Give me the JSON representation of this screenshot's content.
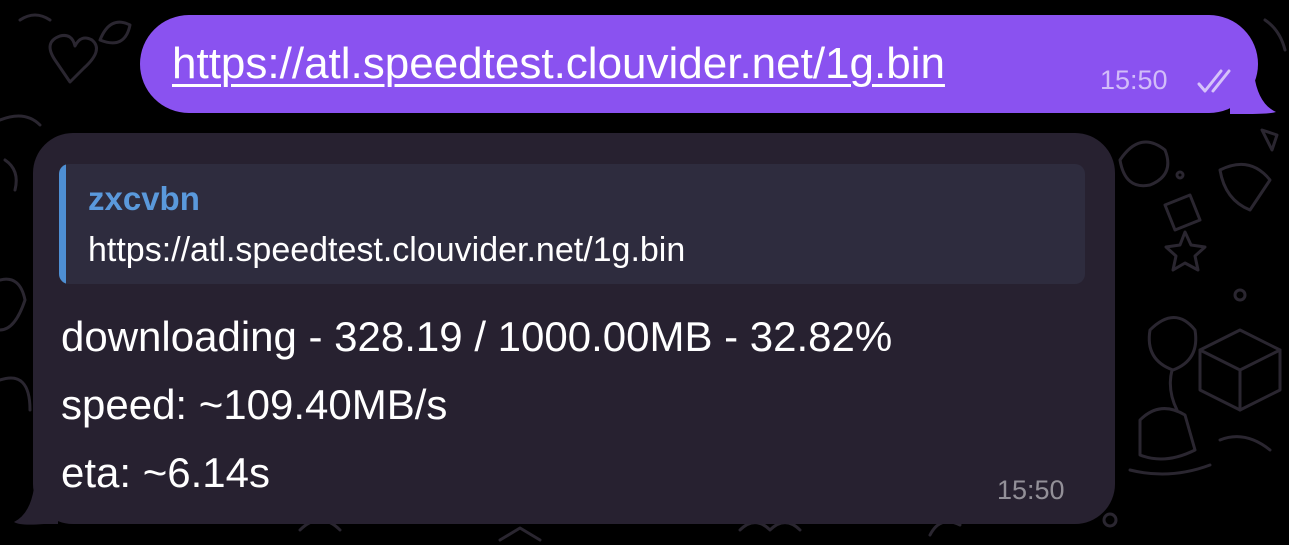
{
  "colors": {
    "background": "#000000",
    "outgoing_bubble": "#8a52f0",
    "incoming_bubble": "#272130",
    "reply_background": "#2e2c3e",
    "reply_accent": "#4e8fd3",
    "reply_name": "#5a99dc"
  },
  "outgoing_message": {
    "link_text": "https://atl.speedtest.clouvider.net/1g.bin",
    "time": "15:50",
    "status_icon": "double-check-icon"
  },
  "incoming_message": {
    "reply": {
      "author": "zxcvbn",
      "text": "https://atl.speedtest.clouvider.net/1g.bin"
    },
    "lines": [
      "downloading - 328.19 / 1000.00MB - 32.82%",
      "speed: ~109.40MB/s",
      "eta: ~6.14s"
    ],
    "time": "15:50"
  }
}
